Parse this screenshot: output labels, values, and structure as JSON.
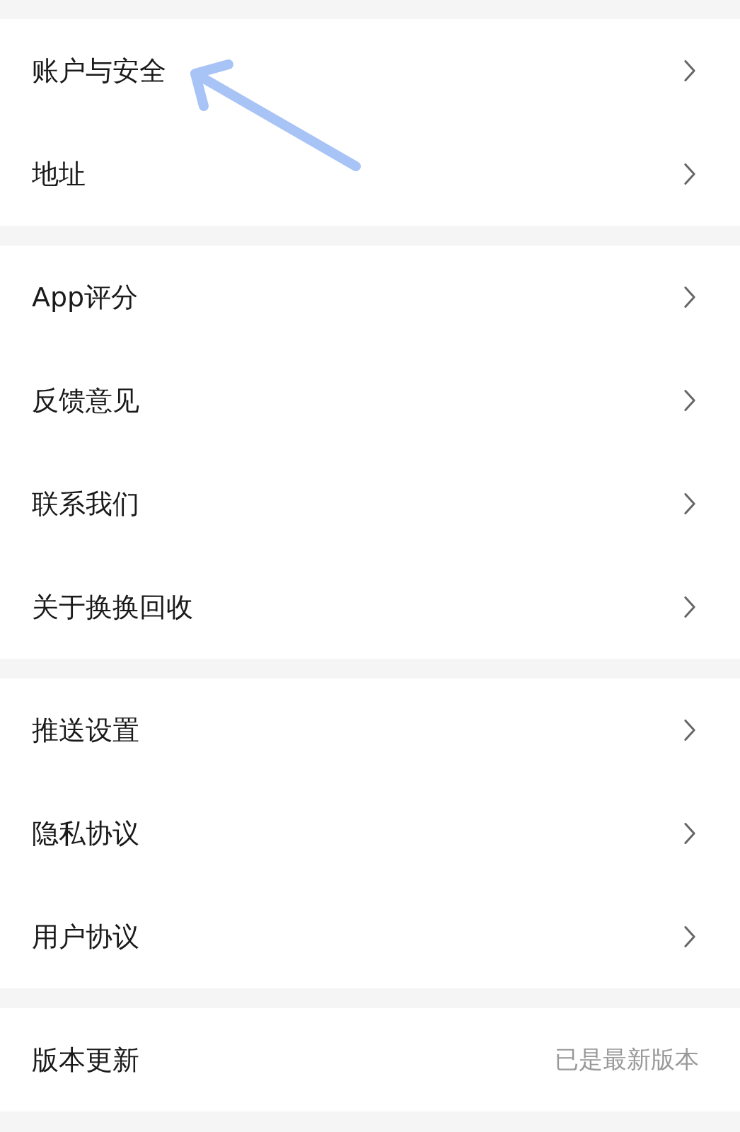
{
  "sections": [
    {
      "items": [
        {
          "label": "账户与安全",
          "kind": "link"
        },
        {
          "label": "地址",
          "kind": "link"
        }
      ]
    },
    {
      "items": [
        {
          "label": "App评分",
          "kind": "link"
        },
        {
          "label": "反馈意见",
          "kind": "link"
        },
        {
          "label": "联系我们",
          "kind": "link"
        },
        {
          "label": "关于换换回收",
          "kind": "link"
        }
      ]
    },
    {
      "items": [
        {
          "label": "推送设置",
          "kind": "link"
        },
        {
          "label": "隐私协议",
          "kind": "link"
        },
        {
          "label": "用户协议",
          "kind": "link"
        }
      ]
    },
    {
      "items": [
        {
          "label": "版本更新",
          "kind": "value",
          "value": "已是最新版本"
        }
      ]
    }
  ]
}
